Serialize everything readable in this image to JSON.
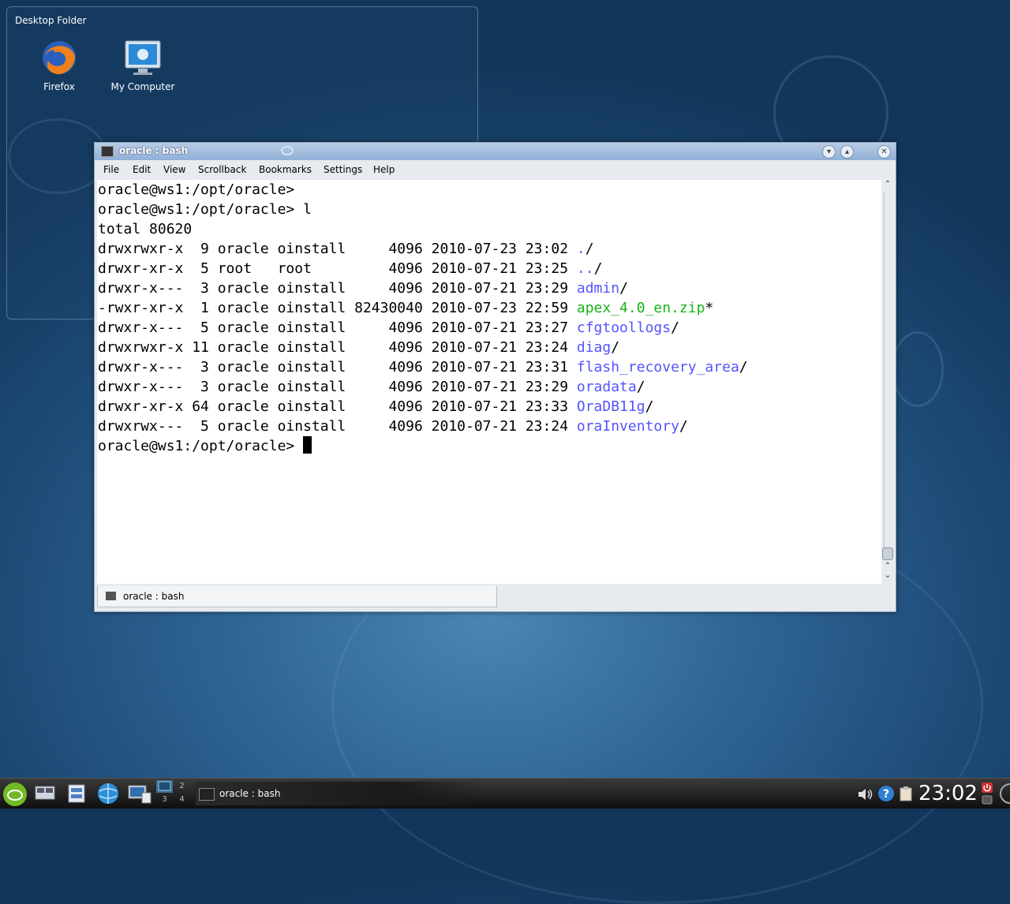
{
  "desktop": {
    "folder_title": "Desktop Folder",
    "icons": [
      {
        "label": "Firefox",
        "icon": "firefox-icon"
      },
      {
        "label": "My Computer",
        "icon": "computer-icon"
      }
    ]
  },
  "window": {
    "title": "oracle : bash",
    "menu": [
      "File",
      "Edit",
      "View",
      "Scrollback",
      "Bookmarks",
      "Settings",
      "Help"
    ],
    "tab_label": "oracle : bash",
    "terminal": {
      "lines": [
        {
          "text": "oracle@ws1:/opt/oracle>"
        },
        {
          "text": "oracle@ws1:/opt/oracle> l"
        },
        {
          "text": "total 80620"
        },
        {
          "text": "drwxrwxr-x  9 oracle oinstall     4096 2010-07-23 23:02 ",
          "name": ".",
          "suffix": "/",
          "kind": "dir"
        },
        {
          "text": "drwxr-xr-x  5 root   root         4096 2010-07-21 23:25 ",
          "name": "..",
          "suffix": "/",
          "kind": "dir"
        },
        {
          "text": "drwxr-x---  3 oracle oinstall     4096 2010-07-21 23:29 ",
          "name": "admin",
          "suffix": "/",
          "kind": "dir"
        },
        {
          "text": "-rwxr-xr-x  1 oracle oinstall 82430040 2010-07-23 22:59 ",
          "name": "apex_4.0_en.zip",
          "suffix": "*",
          "kind": "exe"
        },
        {
          "text": "drwxr-x---  5 oracle oinstall     4096 2010-07-21 23:27 ",
          "name": "cfgtoollogs",
          "suffix": "/",
          "kind": "dir"
        },
        {
          "text": "drwxrwxr-x 11 oracle oinstall     4096 2010-07-21 23:24 ",
          "name": "diag",
          "suffix": "/",
          "kind": "dir"
        },
        {
          "text": "drwxr-x---  3 oracle oinstall     4096 2010-07-21 23:31 ",
          "name": "flash_recovery_area",
          "suffix": "/",
          "kind": "dir"
        },
        {
          "text": "drwxr-x---  3 oracle oinstall     4096 2010-07-21 23:29 ",
          "name": "oradata",
          "suffix": "/",
          "kind": "dir"
        },
        {
          "text": "drwxr-xr-x 64 oracle oinstall     4096 2010-07-21 23:33 ",
          "name": "OraDB11g",
          "suffix": "/",
          "kind": "dir"
        },
        {
          "text": "drwxrwx---  5 oracle oinstall     4096 2010-07-21 23:24 ",
          "name": "oraInventory",
          "suffix": "/",
          "kind": "dir"
        },
        {
          "text": "oracle@ws1:/opt/oracle> ",
          "cursor": true
        }
      ]
    }
  },
  "taskbar": {
    "task_label": "oracle : bash",
    "pager": [
      "1",
      "2",
      "3",
      "4"
    ],
    "clock": "23:02"
  },
  "colors": {
    "dir": "#5454ff",
    "exe": "#18b218"
  }
}
